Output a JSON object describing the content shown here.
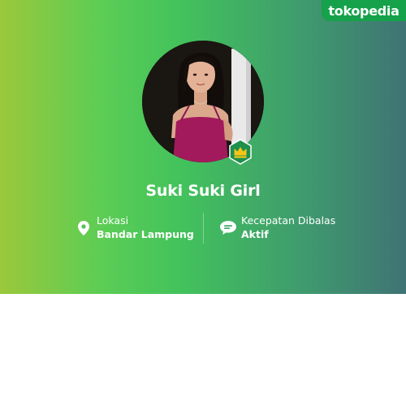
{
  "brand": {
    "logo_text": "tokopedia"
  },
  "shop": {
    "name": "Suki Suki Girl",
    "avatar_icon": "shop-avatar-photo",
    "badge_icon": "crown-icon"
  },
  "info": {
    "location": {
      "icon": "location-pin-icon",
      "label": "Lokasi",
      "value": "Bandar Lampung"
    },
    "response": {
      "icon": "chat-bubble-icon",
      "label": "Kecepatan Dibalas",
      "value": "Aktif"
    }
  },
  "colors": {
    "gradient_left": "#9bc83a",
    "gradient_mid": "#42c25c",
    "gradient_right": "#3f7374",
    "brand_green": "#15a24a",
    "badge_green": "#1f8f4e",
    "crown_gold": "#f5c518"
  }
}
